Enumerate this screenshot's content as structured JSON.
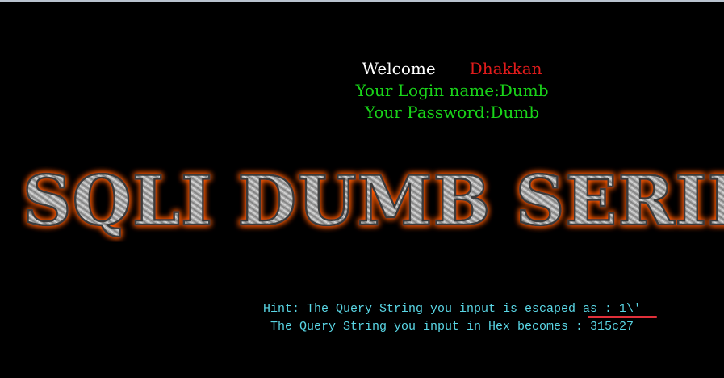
{
  "login": {
    "welcome_label": "Welcome",
    "welcome_name": "Dhakkan",
    "login_name_line": "Your Login name:Dumb",
    "password_line": "Your Password:Dumb"
  },
  "banner": {
    "title": "SQLI DUMB SERIES"
  },
  "hint": {
    "line1": "Hint: The Query String you input is escaped as : 1\\'",
    "line2": "The Query String you input in Hex becomes : 315c27"
  },
  "colors": {
    "background": "#000000",
    "welcome_name": "#e01b1b",
    "login_text": "#19d419",
    "hint_text": "#5ad7e6",
    "banner_glow": "#ff5a00",
    "annotation_underline": "#e0303a"
  }
}
